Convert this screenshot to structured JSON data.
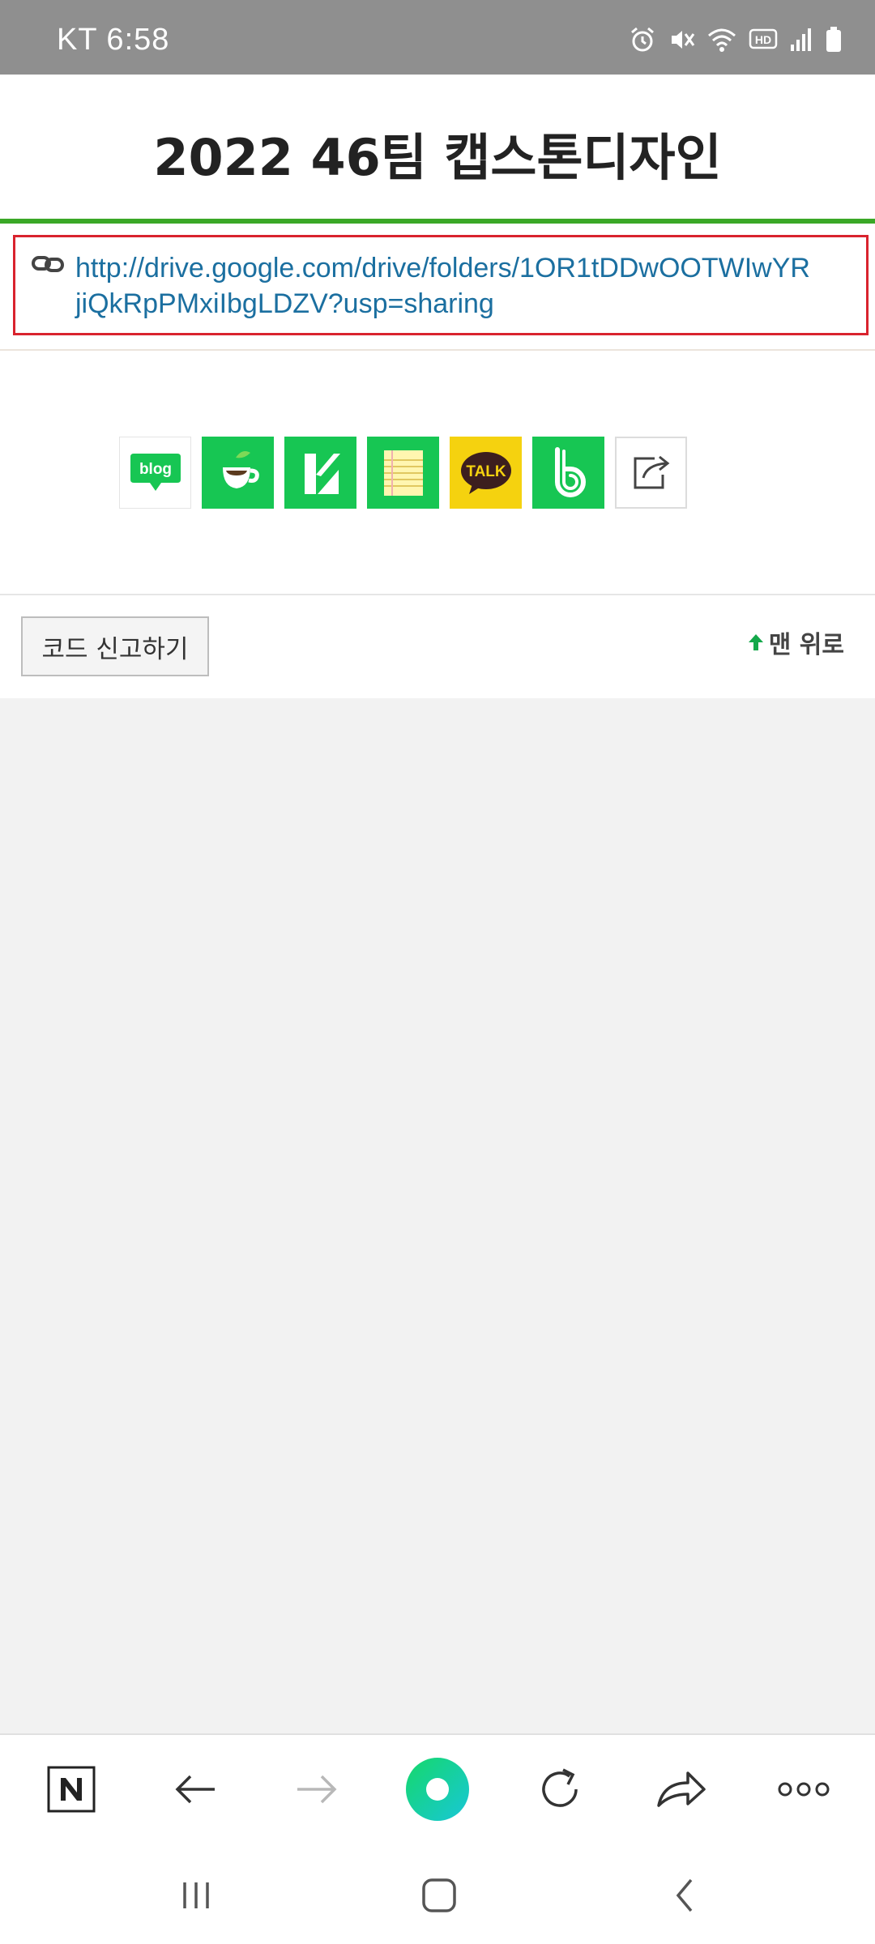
{
  "status_bar": {
    "carrier_time": "KT 6:58",
    "icons": [
      "alarm-icon",
      "mute-icon",
      "wifi-icon",
      "hd-icon",
      "signal-icon",
      "battery-icon"
    ],
    "hd_label": "HD"
  },
  "page": {
    "title": "2022 46팀 캡스톤디자인"
  },
  "link": {
    "icon": "link-icon",
    "line1": "http://drive.google.com/drive/folders/1OR1tDDwOOTWIwYR",
    "line2": "jiQkRpPMxiIbgLDZV?usp=sharing"
  },
  "share": {
    "buttons": [
      {
        "name": "blog",
        "label": "blog"
      },
      {
        "name": "cafe",
        "label": ""
      },
      {
        "name": "k",
        "label": ""
      },
      {
        "name": "memo",
        "label": ""
      },
      {
        "name": "kakaotalk",
        "label": "TALK"
      },
      {
        "name": "band",
        "label": ""
      },
      {
        "name": "share-more",
        "label": ""
      }
    ]
  },
  "actions": {
    "report_label": "코드 신고하기",
    "top_label": "맨 위로"
  },
  "colors": {
    "accent_green": "#3aa827",
    "link_blue": "#1b6fa0",
    "highlight_red": "#d9232e",
    "naver_green": "#17c653",
    "kakao_yellow": "#f5d20f"
  }
}
